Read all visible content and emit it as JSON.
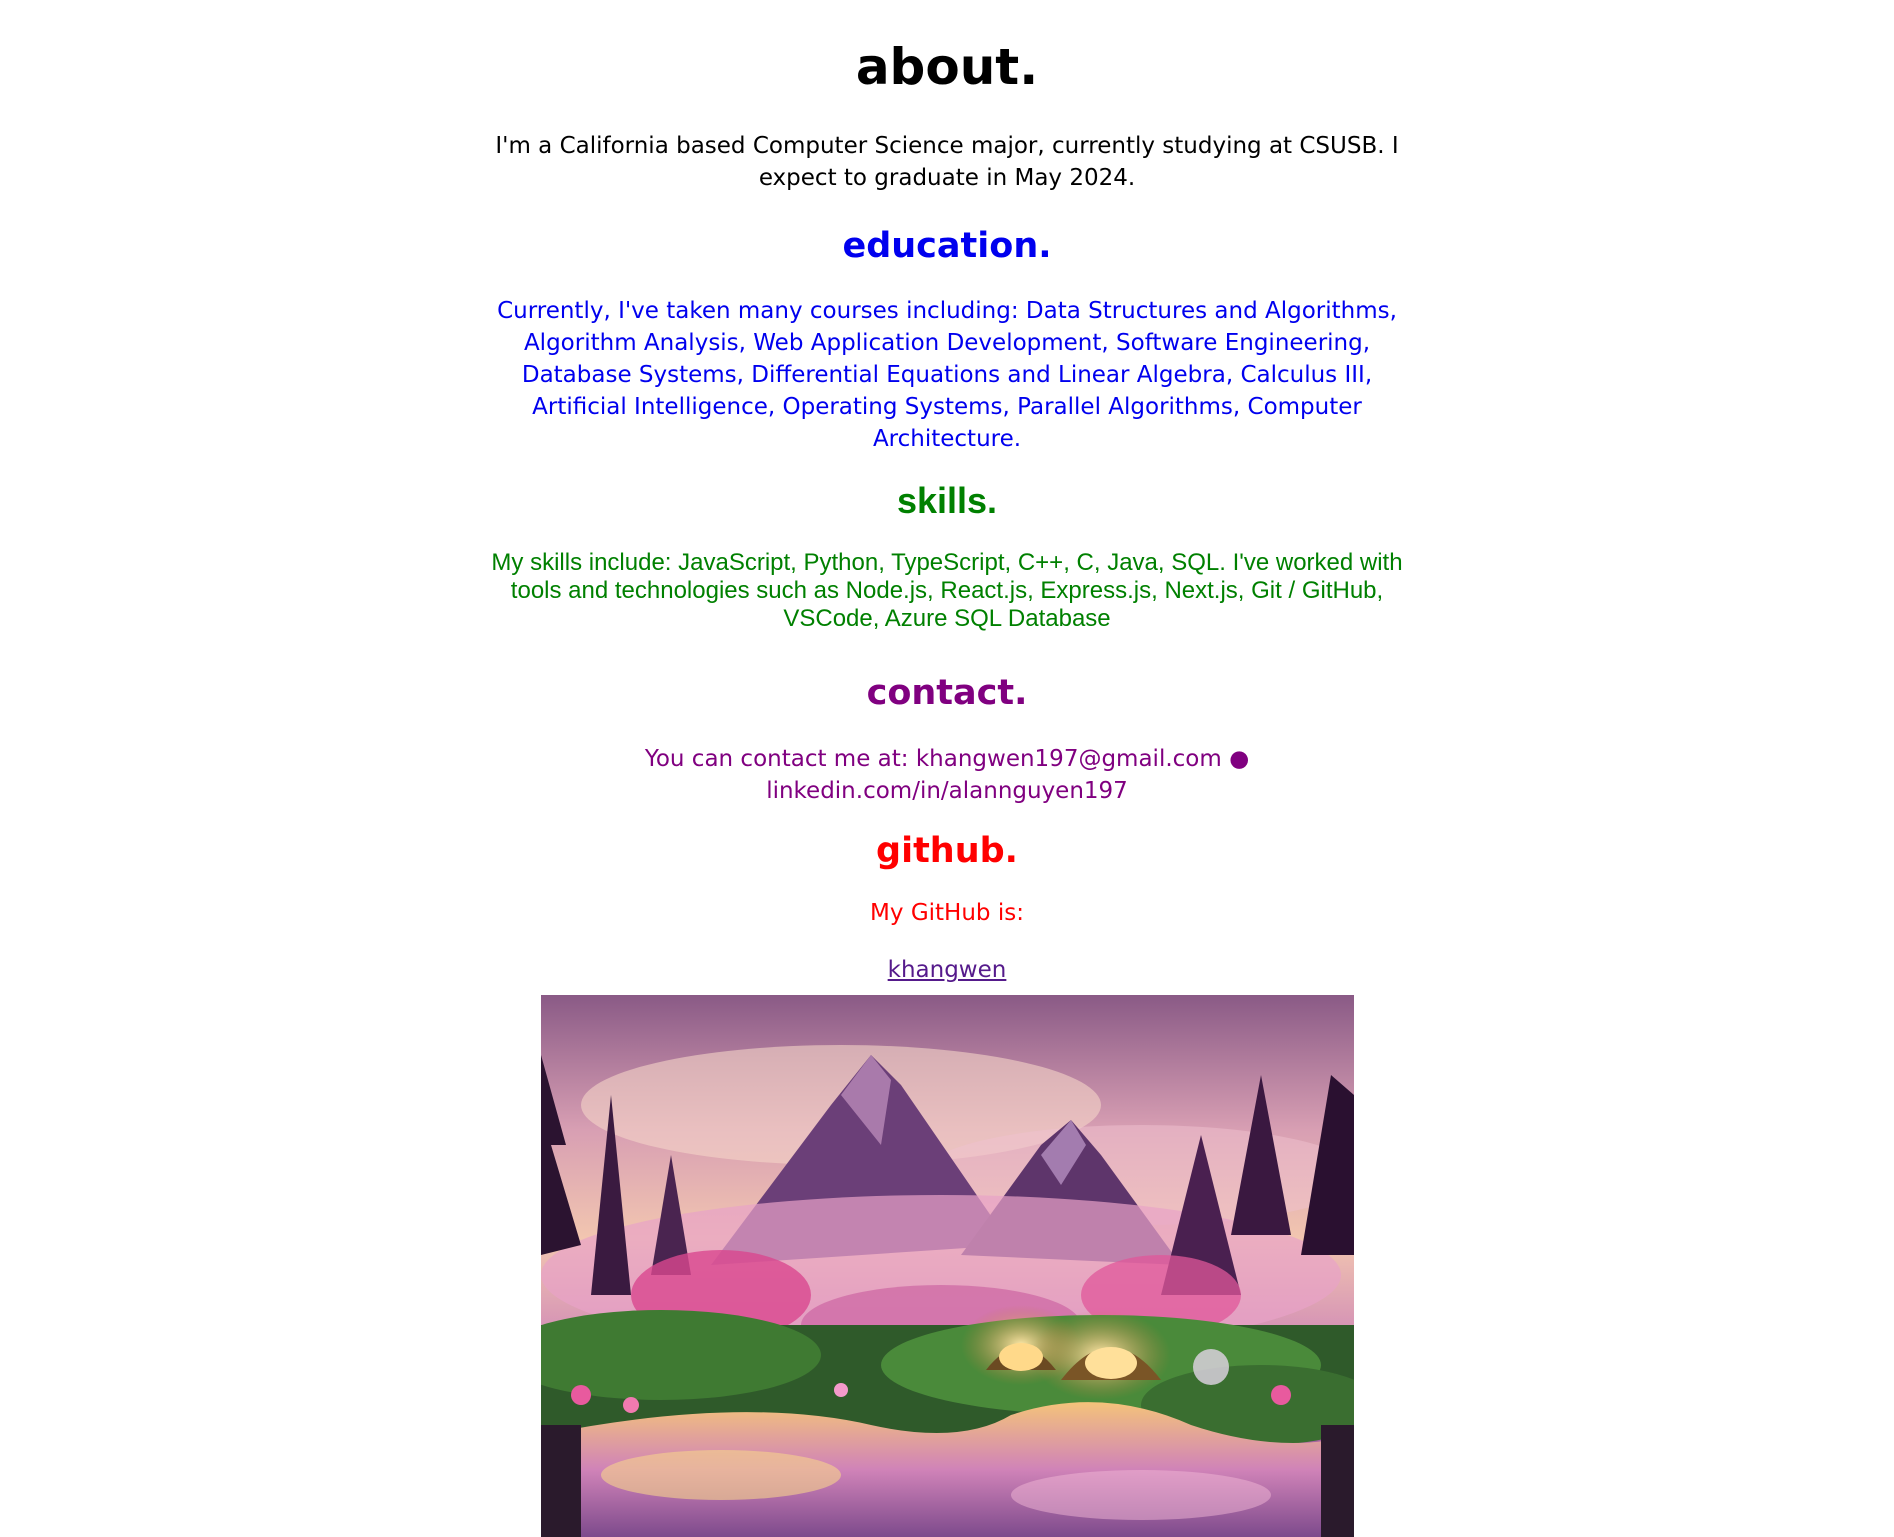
{
  "colors": {
    "about": "#000000",
    "education": "#0000ee",
    "skills": "#008000",
    "contact": "#800080",
    "github": "#ff0000",
    "link": "#551a8b"
  },
  "about": {
    "heading": "about.",
    "text": "I'm a California based Computer Science major, currently studying at CSUSB. I expect to graduate in May 2024."
  },
  "education": {
    "heading": "education.",
    "text": "Currently, I've taken many courses including: Data Structures and Algorithms, Algorithm Analysis, Web Application Development, Software Engineering, Database Systems, Differential Equations and Linear Algebra, Calculus III, Artificial Intelligence, Operating Systems, Parallel Algorithms, Computer Architecture."
  },
  "skills": {
    "heading": "skills.",
    "text": "My skills include: JavaScript, Python, TypeScript, C++, C, Java, SQL. I've worked with tools and technologies such as Node.js, React.js, Express.js, Next.js, Git / GitHub, VSCode, Azure SQL Database"
  },
  "contact": {
    "heading": "contact.",
    "text": "You can contact me at: khangwen197@gmail.com ● linkedin.com/in/alannguyen197"
  },
  "github": {
    "heading": "github.",
    "text": "My GitHub is:",
    "link_label": "khangwen"
  },
  "image": {
    "icon": "fantasy-landscape-image"
  }
}
